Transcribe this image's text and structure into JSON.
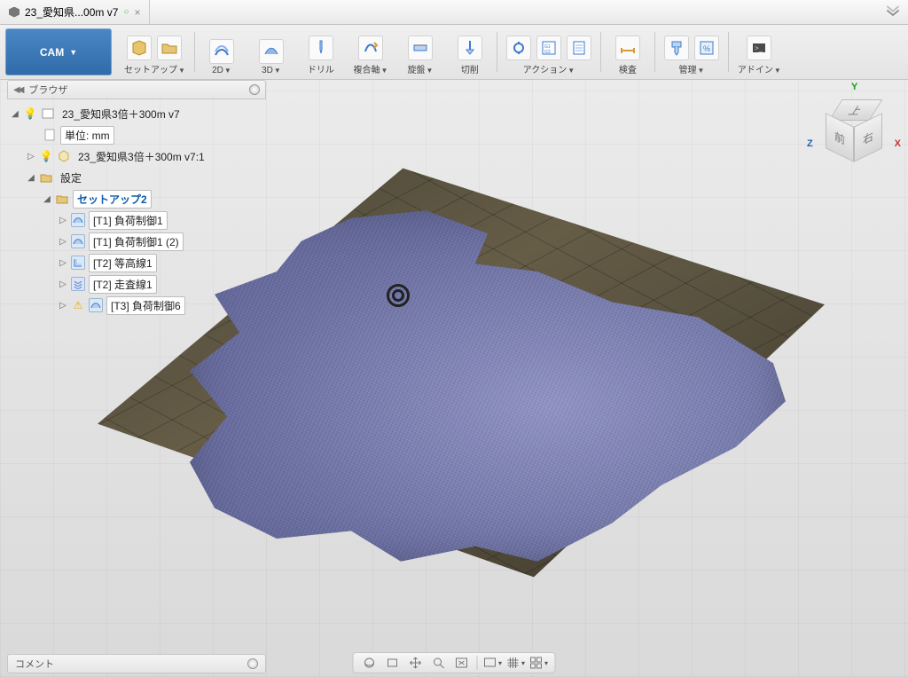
{
  "tab": {
    "title": "23_愛知県...00m v7",
    "dirty": "○",
    "close": "×"
  },
  "workspace": {
    "label": "CAM"
  },
  "ribbon": {
    "setup": "セットアップ",
    "twoD": "2D",
    "threeD": "3D",
    "drill": "ドリル",
    "multiaxis": "複合軸",
    "turning": "旋盤",
    "cutting": "切削",
    "actions": "アクション",
    "inspect": "検査",
    "manage": "管理",
    "addins": "アドイン"
  },
  "browser": {
    "title": "ブラウザ",
    "root": "23_愛知県3倍＋300m v7",
    "units": "単位: mm",
    "comp": "23_愛知県3倍＋300m v7:1",
    "setups": "設定",
    "setup2": "セットアップ2",
    "ops": {
      "o1": "[T1] 負荷制御1",
      "o2": "[T1] 負荷制御1 (2)",
      "o3": "[T2] 等高線1",
      "o4": "[T2] 走査線1",
      "o5": "[T3] 負荷制御6"
    }
  },
  "viewcube": {
    "top": "上",
    "front": "前",
    "right": "右",
    "x": "X",
    "y": "Y",
    "z": "Z"
  },
  "comments": {
    "title": "コメント"
  }
}
